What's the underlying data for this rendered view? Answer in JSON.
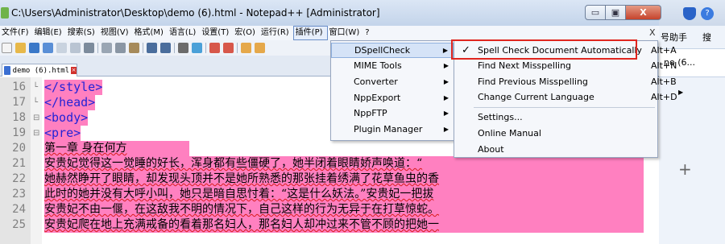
{
  "background_app": {
    "help_tab": "号助手",
    "search_tab": "搜",
    "pane_tab": "no (6...",
    "plus": "+"
  },
  "window": {
    "title": "C:\\Users\\Administrator\\Desktop\\demo (6).html - Notepad++ [Administrator]",
    "minimize": "▭",
    "maximize": "▣",
    "close": "X"
  },
  "menubar": {
    "items": [
      "文件(F)",
      "编辑(E)",
      "搜索(S)",
      "视图(V)",
      "格式(M)",
      "语言(L)",
      "设置(T)",
      "宏(O)",
      "运行(R)",
      "插件(P)",
      "窗口(W)",
      "?"
    ],
    "active_index": 9,
    "close_x": "X"
  },
  "tab": {
    "label": "demo (6).html"
  },
  "editor": {
    "lines": [
      {
        "num": "16",
        "text": "</style>",
        "kind": "tag",
        "fold": "└"
      },
      {
        "num": "17",
        "text": "</head>",
        "kind": "tag",
        "fold": "└"
      },
      {
        "num": "18",
        "text": "<body>",
        "kind": "tag",
        "fold": "⊟"
      },
      {
        "num": "19",
        "text": "<pre>",
        "kind": "tag",
        "fold": "⊟"
      },
      {
        "num": "20",
        "text": "第一章 身在何方",
        "kind": "txt",
        "fold": ""
      },
      {
        "num": "21",
        "text": "        安贵妃觉得这一觉睡的好长，浑身都有些僵硬了，她半闭着眼睛娇声唤道：“",
        "kind": "txt",
        "fold": ""
      },
      {
        "num": "22",
        "text": "        她赫然睁开了眼睛，却发现头顶并不是她所熟悉的那张挂着绣满了花草鱼虫的香",
        "kind": "txt",
        "fold": ""
      },
      {
        "num": "23",
        "text": "        此时的她并没有大呼小叫，她只是暗自思忖着：“这是什么妖法。”安贵妃一把拔",
        "kind": "txt",
        "fold": ""
      },
      {
        "num": "24",
        "text": "        安贵妃不由一偃，在这敌我不明的情况下，自己这样的行为无异于在打草惊蛇。",
        "kind": "txt",
        "fold": ""
      },
      {
        "num": "25",
        "text": "        安贵妃爬在地上充满戒备的看着那名妇人，那名妇人却冲过来不管不顾的把她一",
        "kind": "txt",
        "fold": ""
      }
    ]
  },
  "plugins_menu": {
    "items": [
      {
        "label": "DSpellCheck",
        "submenu": true,
        "highlighted": true
      },
      {
        "label": "MIME Tools",
        "submenu": true,
        "highlighted": false
      },
      {
        "label": "Converter",
        "submenu": true,
        "highlighted": false
      },
      {
        "label": "NppExport",
        "submenu": true,
        "highlighted": false
      },
      {
        "label": "NppFTP",
        "submenu": true,
        "highlighted": false
      },
      {
        "label": "Plugin Manager",
        "submenu": true,
        "highlighted": false
      }
    ],
    "arrow": "▶"
  },
  "dspellcheck_menu": {
    "items": [
      {
        "label": "Spell Check Document Automatically",
        "shortcut": "Alt+A",
        "checked": true
      },
      {
        "label": "Find Next Misspelling",
        "shortcut": "Alt+N",
        "checked": false
      },
      {
        "label": "Find Previous Misspelling",
        "shortcut": "Alt+B",
        "checked": false
      },
      {
        "label": "Change Current Language",
        "shortcut": "Alt+D",
        "checked": false,
        "submenu": true
      },
      {
        "label": "Settings...",
        "shortcut": "",
        "checked": false
      },
      {
        "label": "Online Manual",
        "shortcut": "",
        "checked": false
      },
      {
        "label": "About",
        "shortcut": "",
        "checked": false
      }
    ],
    "check_glyph": "✓",
    "arrow": "▶",
    "highlight_color": "#e0261f"
  }
}
